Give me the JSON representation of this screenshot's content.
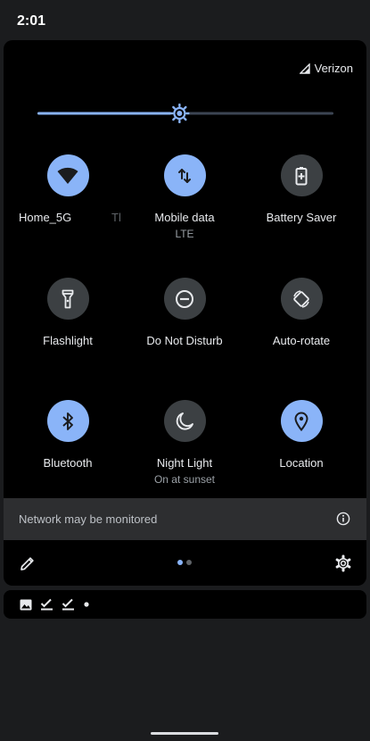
{
  "status": {
    "time": "2:01"
  },
  "carrier": {
    "name": "Verizon"
  },
  "brightness": {
    "level": 0.48
  },
  "tiles": [
    {
      "label": "Home_5G",
      "partial": "Tl",
      "state": "on",
      "icon": "wifi-icon"
    },
    {
      "label": "Mobile data",
      "sublabel": "LTE",
      "state": "on",
      "icon": "mobile-data-icon"
    },
    {
      "label": "Battery Saver",
      "state": "off",
      "icon": "battery-saver-icon"
    },
    {
      "label": "Flashlight",
      "state": "off",
      "icon": "flashlight-icon"
    },
    {
      "label": "Do Not Disturb",
      "state": "off",
      "icon": "do-not-disturb-icon"
    },
    {
      "label": "Auto-rotate",
      "state": "off",
      "icon": "auto-rotate-icon"
    },
    {
      "label": "Bluetooth",
      "state": "on",
      "icon": "bluetooth-icon"
    },
    {
      "label": "Night Light",
      "sublabel": "On at sunset",
      "state": "off",
      "icon": "night-light-icon"
    },
    {
      "label": "Location",
      "state": "on",
      "icon": "location-icon"
    }
  ],
  "footer": {
    "message": "Network may be monitored"
  },
  "pager": {
    "pages": 2,
    "current": 1
  },
  "colors": {
    "accent": "#8ab4f8",
    "tile_off": "#3c4043",
    "panel": "#000000",
    "background": "#1b1c1e"
  }
}
